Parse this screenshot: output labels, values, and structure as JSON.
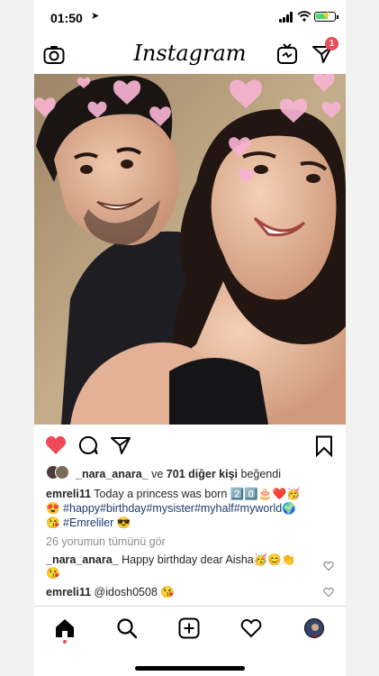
{
  "status_bar": {
    "time": "01:50",
    "location_icon": "location-arrow-icon",
    "battery_color": "#4cd964"
  },
  "nav": {
    "brand": "Instagram",
    "dm_badge": "1",
    "badge_color": "#ed4956"
  },
  "post": {
    "liked": true,
    "like_color": "#ed4956",
    "likes_user": "_nara_anara_",
    "likes_connector": "ve",
    "likes_count": "701 diğer kişi",
    "likes_suffix": "beğendi",
    "caption_user": "emreli11",
    "caption_line1": "Today a princess was born 2️⃣0️⃣🎂❤️🥳",
    "caption_line2": "😍 #happy#birthday#mysister#myhalf#myworld🌍",
    "caption_line3": "😘 #Emreliler 😎",
    "view_comments": "26 yorumun tümünü gör",
    "comments": [
      {
        "user": "_nara_anara_",
        "text": "Happy birthday dear Aisha🥳😊👏",
        "text2": "😘"
      },
      {
        "user": "emreli11",
        "text": "@idosh0508 😘"
      }
    ]
  },
  "tabbar": {
    "items": [
      "home-icon",
      "search-icon",
      "add-post-icon",
      "activity-heart-icon",
      "profile-avatar"
    ]
  }
}
